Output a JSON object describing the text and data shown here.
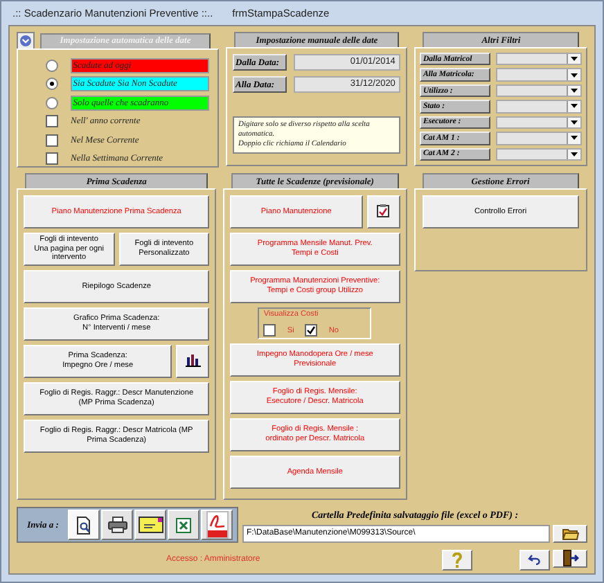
{
  "window": {
    "title": ".:: Scadenzario Manutenzioni Preventive ::..",
    "form_name": "frmStampaScadenze"
  },
  "auto_dates": {
    "title": "Impostazione automatica delle date",
    "options": [
      {
        "kind": "radio",
        "label": "Scadute ad oggi",
        "selected": false,
        "color": "#ff0000"
      },
      {
        "kind": "radio",
        "label": "Sia Scadute Sia Non Scadute",
        "selected": true,
        "color": "#00ffff"
      },
      {
        "kind": "radio",
        "label": "Solo quelle che scadranno",
        "selected": false,
        "color": "#00ff00"
      },
      {
        "kind": "checkbox",
        "label": "Nell' anno corrente",
        "checked": false
      },
      {
        "kind": "checkbox",
        "label": "Nel Mese Corrente",
        "checked": false
      },
      {
        "kind": "checkbox",
        "label": "Nella Settimana Corrente",
        "checked": false
      }
    ]
  },
  "manual_dates": {
    "title": "Impostazione manuale delle date",
    "fields": [
      {
        "label": "Dalla Data:",
        "value": "01/01/2014"
      },
      {
        "label": "Alla Data:",
        "value": "31/12/2020"
      }
    ],
    "hint": "Digitare solo se diverso rispetto alla scelta automatica.\n Doppio clic richiama il Calendario"
  },
  "filters": {
    "title": "Altri Filtri",
    "items": [
      {
        "label": "Dalla Matricol"
      },
      {
        "label": "Alla Matricola:"
      },
      {
        "label": "Utilizzo :"
      },
      {
        "label": "Stato :"
      },
      {
        "label": "Esecutore :"
      },
      {
        "label": "Cat AM 1 :"
      },
      {
        "label": "Cat AM 2 :"
      }
    ]
  },
  "prima_scadenza": {
    "title": "Prima Scadenza",
    "rows": [
      {
        "buttons": [
          {
            "kind": "text",
            "label": "Piano Manutenzione  Prima Scadenza",
            "color": "#ff0000"
          }
        ]
      },
      {
        "buttons": [
          {
            "kind": "text",
            "label": "Fogli di intevento\nUna pagina per ogni\nintervento",
            "color": "#000000"
          },
          {
            "kind": "text",
            "label": "Fogli di intevento\nPersonalizzato",
            "color": "#000000"
          }
        ]
      },
      {
        "buttons": [
          {
            "kind": "text",
            "label": "Riepilogo   Scadenze",
            "color": "#000000"
          }
        ]
      },
      {
        "buttons": [
          {
            "kind": "text",
            "label": "Grafico Prima Scadenza:\nN° Interventi / mese",
            "color": "#000000"
          }
        ]
      },
      {
        "buttons": [
          {
            "kind": "text",
            "label": "Prima  Scadenza:\nImpegno Ore / mese",
            "color": "#000000"
          },
          {
            "kind": "chart"
          }
        ]
      },
      {
        "buttons": [
          {
            "kind": "text",
            "label": "Foglio di Regis. Raggr.: Descr Manutenzione\n(MP Prima Scadenza)",
            "color": "#000000"
          }
        ]
      },
      {
        "buttons": [
          {
            "kind": "text",
            "label": "Foglio di Regis. Raggr.: Descr Matricola (MP\nPrima Scadenza)",
            "color": "#000000"
          }
        ]
      }
    ]
  },
  "tutte_scadenze": {
    "title": "Tutte le Scadenze (previsionale)",
    "rows": [
      {
        "buttons": [
          {
            "kind": "text",
            "label": "Piano Manutenzione",
            "color": "#ff0000"
          },
          {
            "kind": "clipboard"
          }
        ]
      },
      {
        "buttons": [
          {
            "kind": "text",
            "label": "Programma Mensile Manut. Prev.\nTempi e Costi",
            "color": "#ff0000"
          }
        ]
      },
      {
        "buttons": [
          {
            "kind": "text",
            "label": "Programma Manutenzioni Preventive:\nTempi e Costi group  Utilizzo",
            "color": "#ff0000"
          }
        ]
      },
      {
        "costs": {
          "title": "Visualizza Costi",
          "options": [
            {
              "label": "Si",
              "checked": false
            },
            {
              "label": "No",
              "checked": true
            }
          ]
        }
      },
      {
        "buttons": [
          {
            "kind": "text",
            "label": "Impegno Manodopera Ore / mese\nPrevisionale",
            "color": "#ff0000"
          }
        ]
      },
      {
        "buttons": [
          {
            "kind": "text",
            "label": "Foglio di Regis. Mensile:\nEsecutore / Descr.  Matricola",
            "color": "#ff0000"
          }
        ]
      },
      {
        "buttons": [
          {
            "kind": "text",
            "label": "Foglio di Regis. Mensile :\nordinato per Descr.  Matricola",
            "color": "#ff0000"
          }
        ]
      },
      {
        "buttons": [
          {
            "kind": "text",
            "label": "Agenda Mensile",
            "color": "#ff0000"
          }
        ]
      }
    ]
  },
  "gestione_errori": {
    "title": "Gestione Errori",
    "buttons": [
      {
        "label": "Controllo Errori"
      }
    ]
  },
  "send_to": {
    "label": "Invia a :",
    "buttons": [
      {
        "kind": "preview"
      },
      {
        "kind": "printer"
      },
      {
        "kind": "mail"
      },
      {
        "kind": "excel"
      },
      {
        "kind": "pdf"
      }
    ]
  },
  "save_folder": {
    "label": "Cartella Predefinita salvataggio file (excel o PDF)  :",
    "value": "F:\\DataBase\\Manutenzione\\M099313\\Source\\"
  },
  "access": "Accesso : Amministratore",
  "footer_buttons": [
    {
      "kind": "help"
    },
    {
      "kind": "undo"
    },
    {
      "kind": "exit"
    }
  ]
}
